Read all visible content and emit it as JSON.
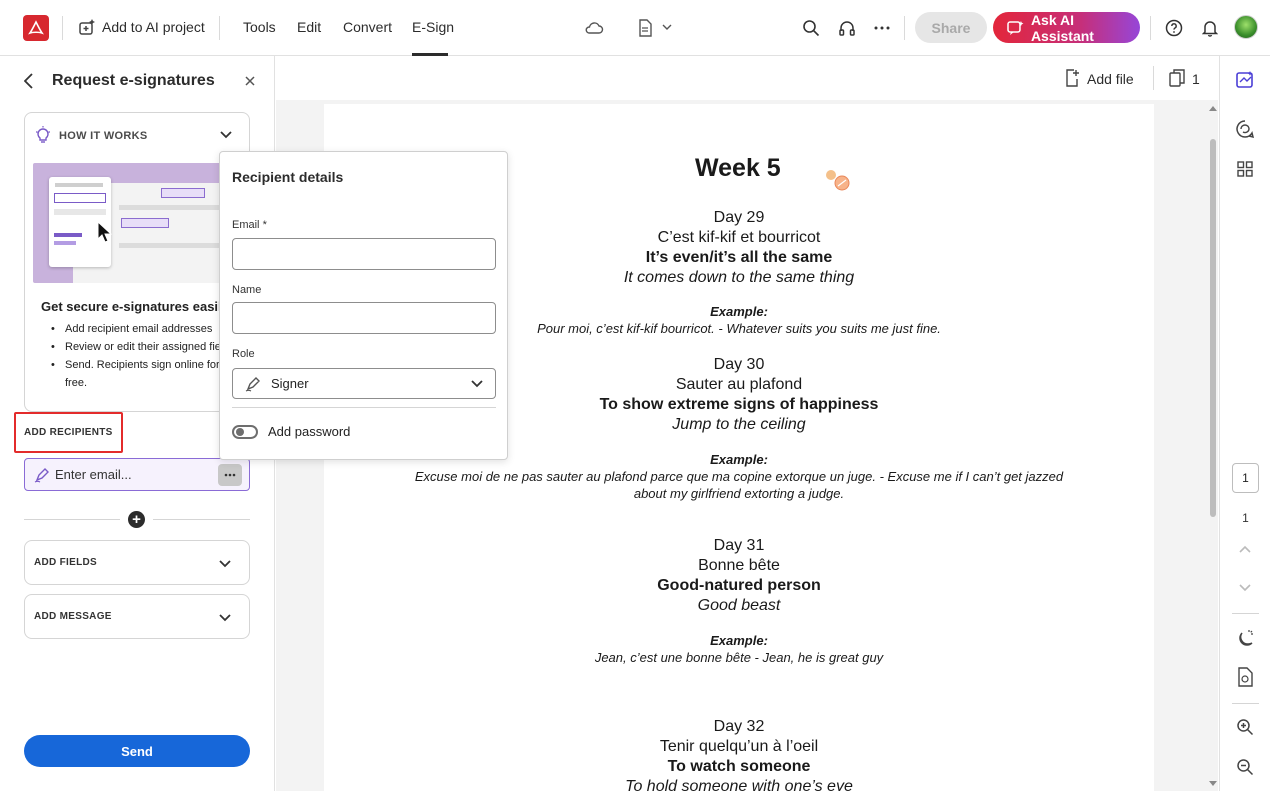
{
  "topbar": {
    "add_to_ai_label": "Add to AI project",
    "menu": [
      "Tools",
      "Edit",
      "Convert",
      "E-Sign"
    ],
    "active_menu": "E-Sign",
    "share_label": "Share",
    "ai_assistant_label": "Ask AI Assistant",
    "icons": [
      "acrobat-logo-icon",
      "ai-project-icon",
      "cloud-icon",
      "document-icon",
      "chevron-down-icon",
      "search-icon",
      "headphones-icon",
      "more-icon",
      "help-icon",
      "bell-icon",
      "avatar"
    ]
  },
  "left_panel": {
    "title": "Request e-signatures",
    "how_it_works": {
      "label": "HOW IT WORKS",
      "heading": "Get secure e-signatures easily",
      "bullets": [
        "Add recipient email addresses",
        "Review or edit their assigned fie",
        "Send. Recipients sign online for free."
      ]
    },
    "add_recipients_label": "ADD RECIPIENTS",
    "email_placeholder": "Enter email...",
    "add_fields_label": "ADD FIELDS",
    "add_message_label": "ADD MESSAGE",
    "send_label": "Send",
    "accent_color": "#1767d9",
    "highlight_color": "#e32b2b"
  },
  "recipient_popup": {
    "title": "Recipient details",
    "email_label": "Email",
    "required_mark": "*",
    "email_value": "",
    "name_label": "Name",
    "name_value": "",
    "role_label": "Role",
    "role_value": "Signer",
    "password_label": "Add password",
    "password_enabled": false
  },
  "doc_toolbar": {
    "add_file_label": "Add file",
    "page_count": "1"
  },
  "document": {
    "week_title": "Week 5",
    "entries": [
      {
        "day": "Day 29",
        "french": "C’est kif-kif et bourricot",
        "meaning": "It’s even/it’s all the same",
        "literal": "It comes down to the same thing",
        "example_label": "Example:",
        "example": "Pour moi, c’est kif-kif bourricot. - Whatever suits you suits me just fine."
      },
      {
        "day": "Day 30",
        "french": "Sauter au plafond",
        "meaning": "To show extreme signs of happiness",
        "literal": "Jump to the ceiling",
        "example_label": "Example:",
        "example_line1": "Excuse moi de ne pas sauter au plafond parce que ma copine extorque un juge. - Excuse me if I can’t get jazzed",
        "example_line2": "about my girlfriend extorting a judge."
      },
      {
        "day": "Day 31",
        "french": "Bonne bête",
        "meaning": "Good-natured person",
        "literal": "Good beast",
        "example_label": "Example:",
        "example": "Jean, c’est une bonne bête - Jean, he is great guy"
      },
      {
        "day": "Day 32",
        "french": "Tenir quelqu’un à l’oeil",
        "meaning": "To watch someone",
        "literal": "To hold someone with one’s eye"
      }
    ]
  },
  "right_rail": {
    "current_page": "1",
    "total_pages": "1",
    "icons": [
      "edit-pdf-icon",
      "comment-icon",
      "grid-icon",
      "chevron-up-icon",
      "chevron-down-icon",
      "night-mode-icon",
      "page-settings-icon",
      "zoom-in-icon",
      "zoom-out-icon"
    ]
  }
}
